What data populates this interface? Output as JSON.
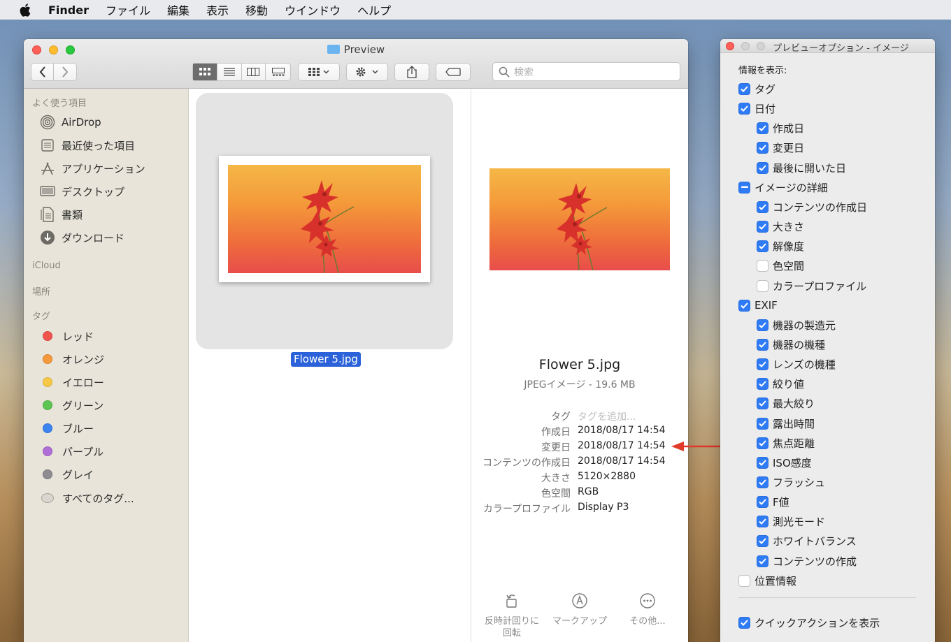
{
  "menubar": {
    "app_name": "Finder",
    "items": [
      "ファイル",
      "編集",
      "表示",
      "移動",
      "ウインドウ",
      "ヘルプ"
    ]
  },
  "finder": {
    "title": "Preview",
    "search_placeholder": "検索",
    "sidebar": {
      "favorites_header": "よく使う項目",
      "favorites": [
        {
          "label": "AirDrop",
          "icon": "airdrop-icon"
        },
        {
          "label": "最近使った項目",
          "icon": "recents-icon"
        },
        {
          "label": "アプリケーション",
          "icon": "applications-icon"
        },
        {
          "label": "デスクトップ",
          "icon": "desktop-icon"
        },
        {
          "label": "書類",
          "icon": "documents-icon"
        },
        {
          "label": "ダウンロード",
          "icon": "downloads-icon"
        }
      ],
      "icloud_header": "iCloud",
      "locations_header": "場所",
      "tags_header": "タグ",
      "tags": [
        {
          "label": "レッド",
          "color": "#f0544f"
        },
        {
          "label": "オレンジ",
          "color": "#f59a3c"
        },
        {
          "label": "イエロー",
          "color": "#f6c846"
        },
        {
          "label": "グリーン",
          "color": "#5ec452"
        },
        {
          "label": "ブルー",
          "color": "#3d84f1"
        },
        {
          "label": "パープル",
          "color": "#b06fd6"
        },
        {
          "label": "グレイ",
          "color": "#8e8e92"
        },
        {
          "label": "すべてのタグ...",
          "color": "#d8d6cf"
        }
      ]
    },
    "selected_file": "Flower 5.jpg",
    "preview": {
      "name": "Flower 5.jpg",
      "kind": "JPEGイメージ - 19.6 MB",
      "metadata": [
        {
          "key": "タグ",
          "value": "タグを追加..."
        },
        {
          "key": "作成日",
          "value": "2018/08/17 14:54"
        },
        {
          "key": "変更日",
          "value": "2018/08/17 14:54"
        },
        {
          "key": "コンテンツの作成日",
          "value": "2018/08/17 14:54"
        },
        {
          "key": "大きさ",
          "value": "5120×2880"
        },
        {
          "key": "色空間",
          "value": "RGB"
        },
        {
          "key": "カラープロファイル",
          "value": "Display P3"
        }
      ],
      "actions": [
        {
          "label_line1": "反時計回りに",
          "label_line2": "回転"
        },
        {
          "label_line1": "マークアップ",
          "label_line2": ""
        },
        {
          "label_line1": "その他...",
          "label_line2": ""
        }
      ]
    }
  },
  "options_panel": {
    "title": "プレビューオプション - イメージ",
    "header": "情報を表示:",
    "items": [
      {
        "label": "タグ",
        "state": "on",
        "indent": 0
      },
      {
        "label": "日付",
        "state": "on",
        "indent": 0
      },
      {
        "label": "作成日",
        "state": "on",
        "indent": 1
      },
      {
        "label": "変更日",
        "state": "on",
        "indent": 1
      },
      {
        "label": "最後に開いた日",
        "state": "on",
        "indent": 1
      },
      {
        "label": "イメージの詳細",
        "state": "mixed",
        "indent": 0
      },
      {
        "label": "コンテンツの作成日",
        "state": "on",
        "indent": 1
      },
      {
        "label": "大きさ",
        "state": "on",
        "indent": 1
      },
      {
        "label": "解像度",
        "state": "on",
        "indent": 1
      },
      {
        "label": "色空間",
        "state": "off",
        "indent": 1
      },
      {
        "label": "カラープロファイル",
        "state": "off",
        "indent": 1
      },
      {
        "label": "EXIF",
        "state": "on",
        "indent": 0
      },
      {
        "label": "機器の製造元",
        "state": "on",
        "indent": 1
      },
      {
        "label": "機器の機種",
        "state": "on",
        "indent": 1
      },
      {
        "label": "レンズの機種",
        "state": "on",
        "indent": 1
      },
      {
        "label": "絞り値",
        "state": "on",
        "indent": 1
      },
      {
        "label": "最大絞り",
        "state": "on",
        "indent": 1
      },
      {
        "label": "露出時間",
        "state": "on",
        "indent": 1
      },
      {
        "label": "焦点距離",
        "state": "on",
        "indent": 1
      },
      {
        "label": "ISO感度",
        "state": "on",
        "indent": 1
      },
      {
        "label": "フラッシュ",
        "state": "on",
        "indent": 1
      },
      {
        "label": "F値",
        "state": "on",
        "indent": 1
      },
      {
        "label": "測光モード",
        "state": "on",
        "indent": 1
      },
      {
        "label": "ホワイトバランス",
        "state": "on",
        "indent": 1
      },
      {
        "label": "コンテンツの作成",
        "state": "on",
        "indent": 1
      },
      {
        "label": "位置情報",
        "state": "off",
        "indent": 0
      }
    ],
    "quick_actions": {
      "label": "クイックアクションを表示",
      "state": "on"
    }
  },
  "colors": {
    "accent": "#2f7bf5",
    "selection": "#2b62d9",
    "annotation_arrow": "#e03a2a"
  }
}
